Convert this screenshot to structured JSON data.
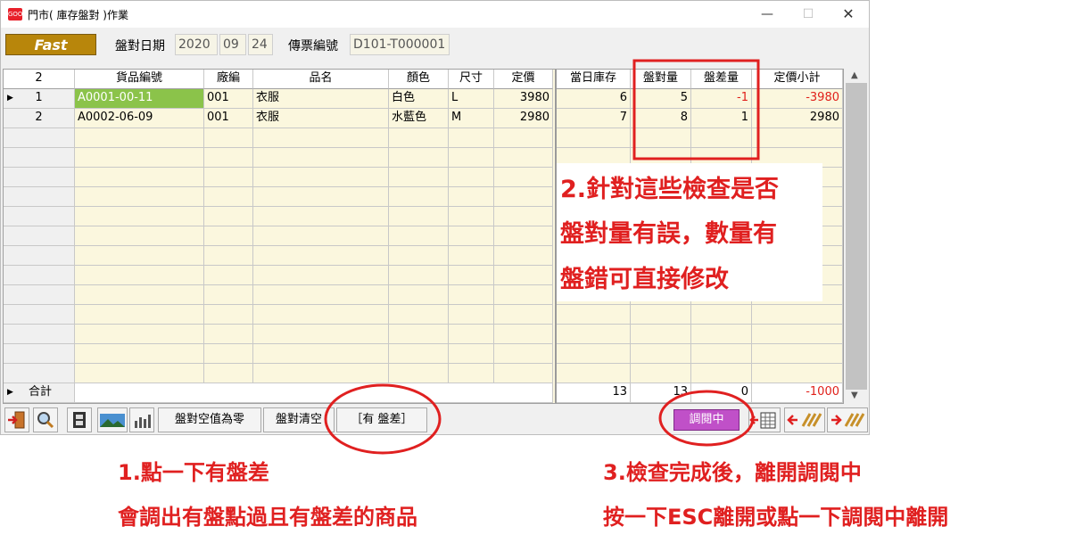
{
  "window": {
    "title": "門市( 庫存盤對 )作業",
    "app_icon_text": "GOOD",
    "min_symbol": "—",
    "max_symbol": "☐",
    "close_symbol": "✕"
  },
  "header": {
    "fast_label": "Fast",
    "date_label": "盤對日期",
    "date_year": "2020",
    "date_month": "09",
    "date_day": "24",
    "voucher_label": "傳票編號",
    "voucher_value": "D101-T000001"
  },
  "grid": {
    "record_count": "2",
    "columns": [
      "貨品編號",
      "廠編",
      "品名",
      "顏色",
      "尺寸",
      "定價",
      "當日庫存",
      "盤對量",
      "盤差量",
      "定價小計"
    ],
    "rows": [
      {
        "no": "1",
        "item_code": "A0001-00-11",
        "vendor": "001",
        "name": "衣服",
        "color": "白色",
        "size": "L",
        "price": "3980",
        "stock": "6",
        "counted": "5",
        "diff": "-1",
        "subtotal": "-3980"
      },
      {
        "no": "2",
        "item_code": "A0002-06-09",
        "vendor": "001",
        "name": "衣服",
        "color": "水藍色",
        "size": "M",
        "price": "2980",
        "stock": "7",
        "counted": "8",
        "diff": "1",
        "subtotal": "2980"
      }
    ],
    "totals": {
      "label": "合計",
      "stock": "13",
      "counted": "13",
      "diff": "0",
      "subtotal": "-1000"
    }
  },
  "toolbar": {
    "zero_empty": "盤對空值為零",
    "clear_counts": "盤對清空",
    "has_diff": "［有 盤差］",
    "reading": "調閱中"
  },
  "annotations": {
    "step2": [
      "2.針對這些檢查是否",
      "盤對量有誤，數量有",
      "盤錯可直接修改"
    ],
    "step1_title": "1.點一下有盤差",
    "step1_desc": "會調出有盤點過且有盤差的商品",
    "step3_title": "3.檢查完成後，離開調閱中",
    "step3_desc": "按一下ESC離開或點一下調閱中離開"
  },
  "colors": {
    "fast_bg": "#b8860b",
    "grid_bg": "#fbf7de",
    "selected_cell": "#8bc34a",
    "negative_value": "#e0201a",
    "reading_bg": "#c050c8",
    "annotation": "#e02020"
  }
}
